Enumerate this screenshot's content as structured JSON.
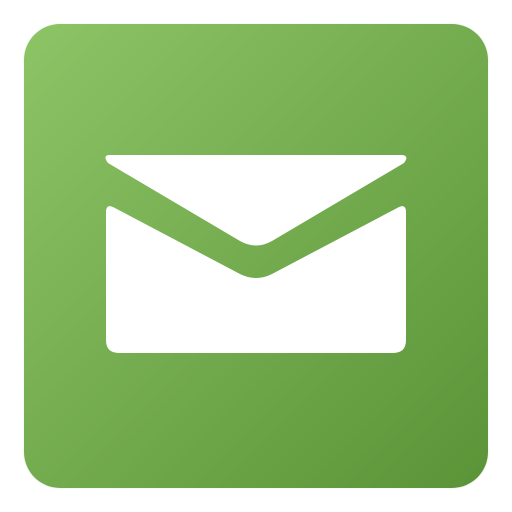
{
  "app_icon": {
    "icon": "mail-icon",
    "tile_color_light": "#8cc466",
    "tile_color_dark": "#5b9338",
    "glyph_color": "#ffffff"
  }
}
